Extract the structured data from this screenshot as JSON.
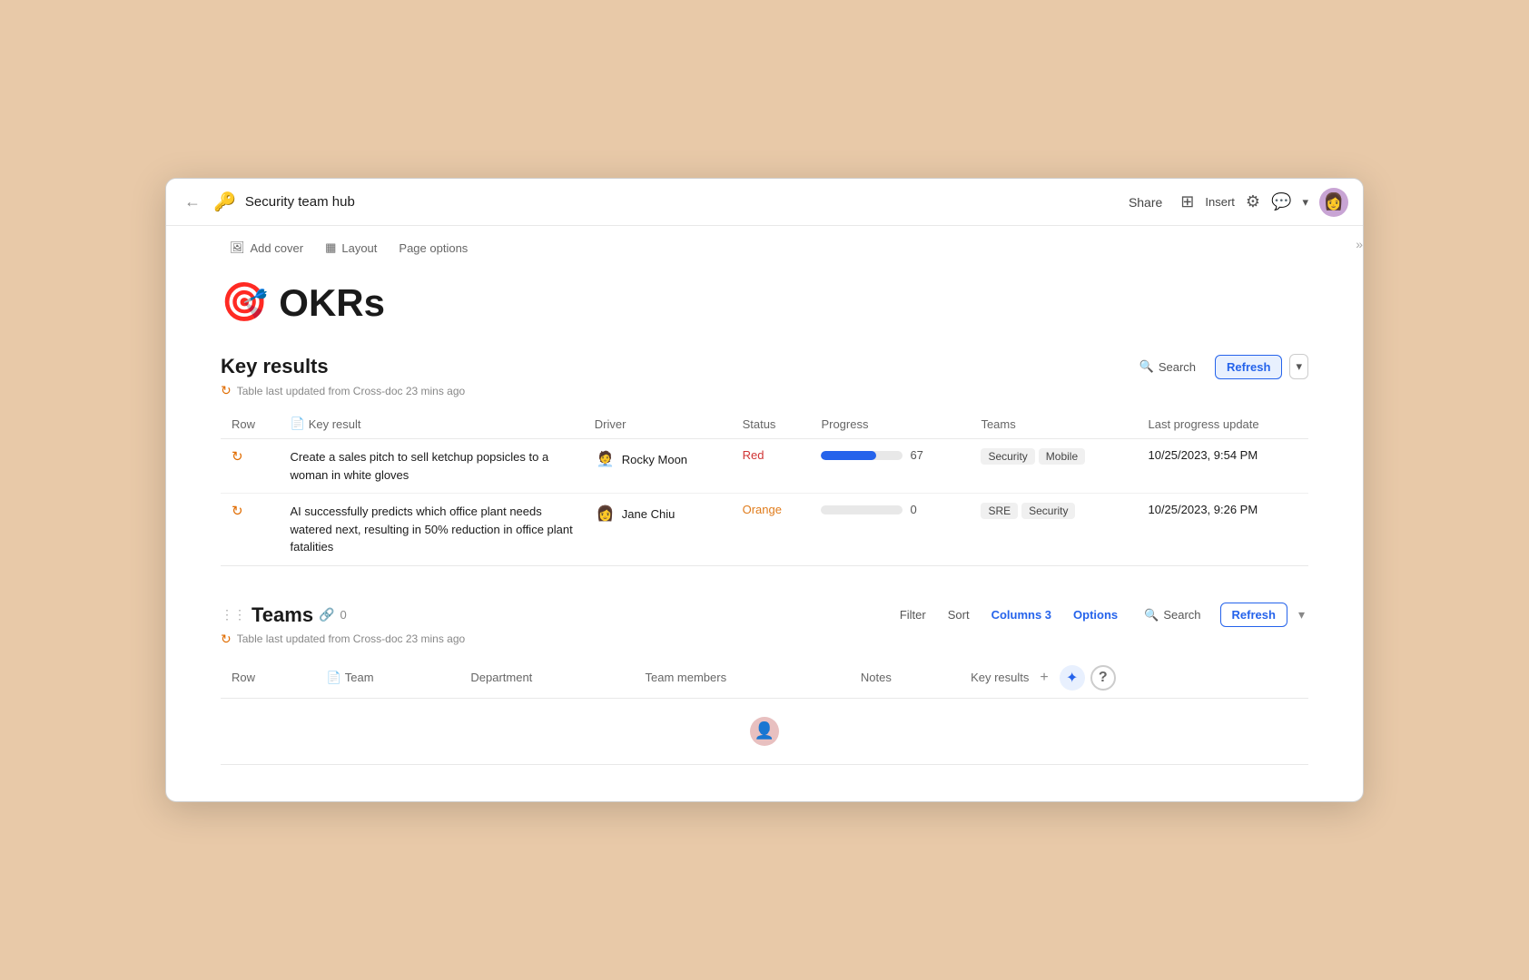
{
  "window": {
    "title": "Security team hub",
    "icon": "🔑"
  },
  "titlebar": {
    "back_label": "←",
    "share_label": "Share",
    "insert_label": "Insert",
    "avatar_emoji": "👩"
  },
  "page_controls": {
    "add_cover": "Add cover",
    "layout": "Layout",
    "page_options": "Page options"
  },
  "okr": {
    "emoji": "🎯",
    "title": "OKRs"
  },
  "key_results": {
    "section_title": "Key results",
    "search_label": "Search",
    "refresh_label": "Refresh",
    "updated_text": "Table last updated from Cross-doc 23 mins ago",
    "columns": {
      "row": "Row",
      "key_result": "Key result",
      "driver": "Driver",
      "status": "Status",
      "progress": "Progress",
      "teams": "Teams",
      "last_progress_update": "Last progress update"
    },
    "rows": [
      {
        "key_result": "Create a sales pitch to sell ketchup popsicles to a woman in white gloves",
        "driver": "Rocky Moon",
        "driver_emoji": "🧑‍💼",
        "status": "Red",
        "progress_pct": 67,
        "teams": [
          "Security",
          "Mobile"
        ],
        "last_update": "10/25/2023, 9:54 PM"
      },
      {
        "key_result": "AI successfully predicts which office plant needs watered next, resulting in 50% reduction in office plant fatalities",
        "driver": "Jane Chiu",
        "driver_emoji": "👩",
        "status": "Orange",
        "progress_pct": 0,
        "teams": [
          "SRE",
          "Security"
        ],
        "last_update": "10/25/2023, 9:26 PM"
      }
    ]
  },
  "teams": {
    "section_title": "Teams",
    "link_count": "0",
    "filter_label": "Filter",
    "sort_label": "Sort",
    "columns_label": "Columns 3",
    "options_label": "Options",
    "search_label": "Search",
    "refresh_label": "Refresh",
    "updated_text": "Table last updated from Cross-doc 23 mins ago",
    "columns": {
      "row": "Row",
      "team": "Team",
      "department": "Department",
      "team_members": "Team members",
      "notes": "Notes",
      "key_results": "Key results"
    }
  },
  "colors": {
    "primary_blue": "#2563eb",
    "progress_fill": "#2563eb",
    "red_status": "#d03434",
    "orange_status": "#e07c1c",
    "tag_bg": "#f0f0f0"
  }
}
